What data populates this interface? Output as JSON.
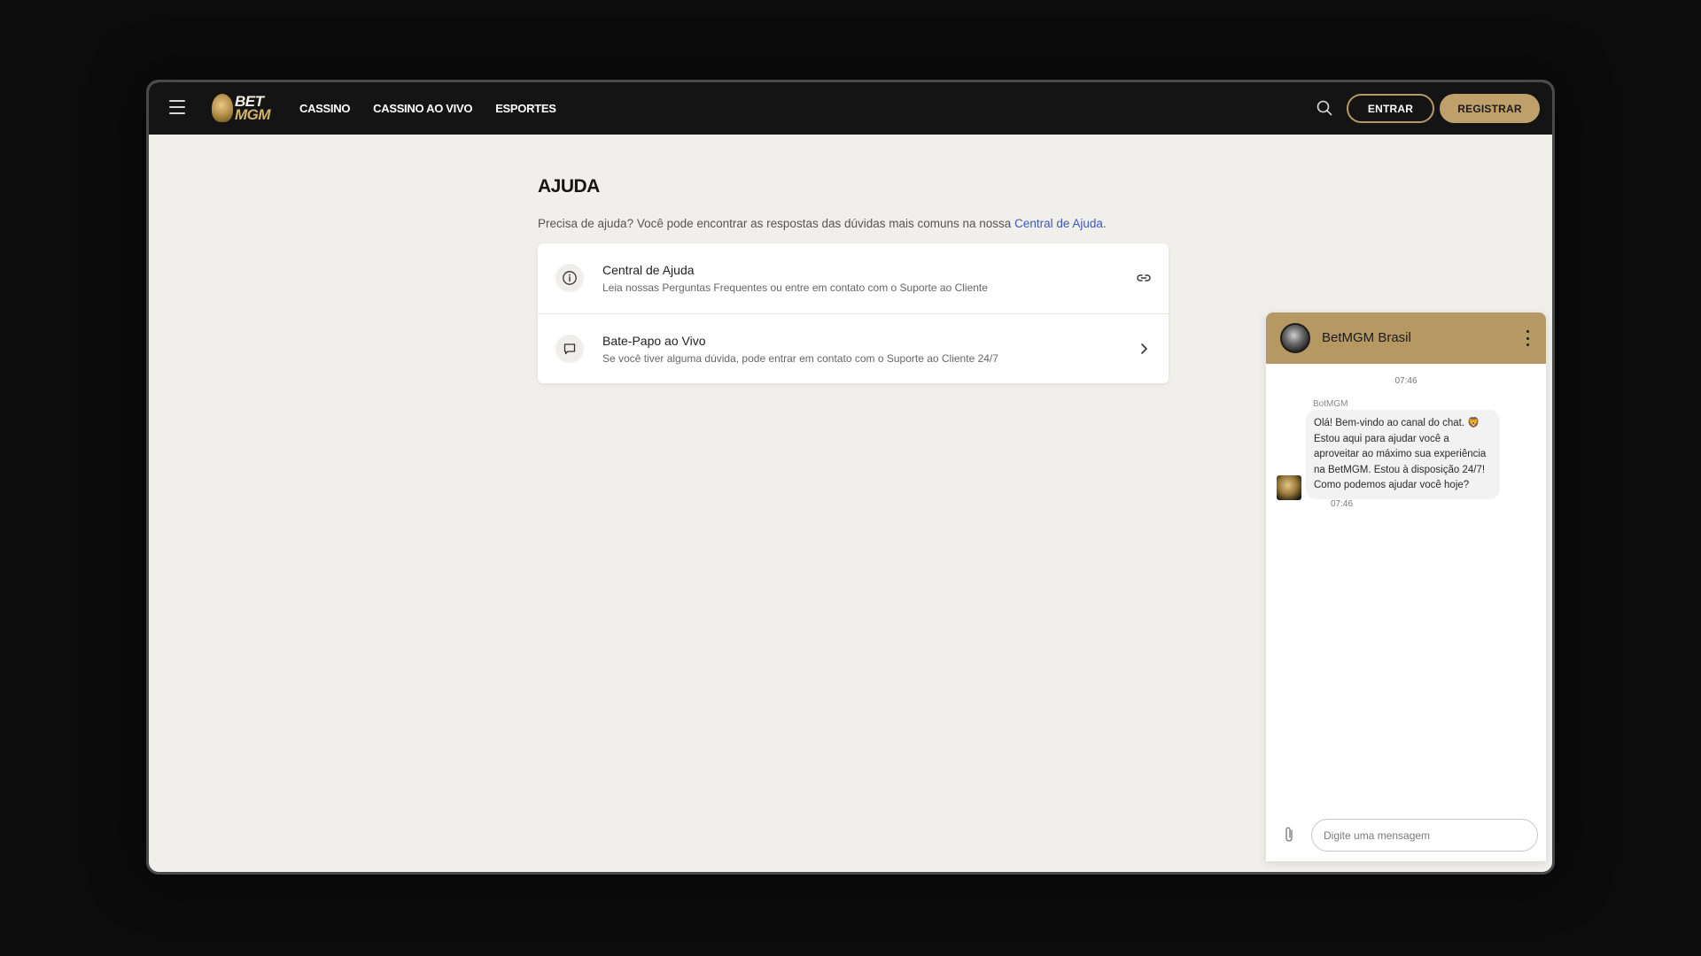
{
  "header": {
    "logo_text_top": "BET",
    "logo_text_bottom": "MGM",
    "nav": [
      {
        "label": "CASSINO"
      },
      {
        "label": "CASSINO AO VIVO"
      },
      {
        "label": "ESPORTES"
      }
    ],
    "login_label": "ENTRAR",
    "register_label": "REGISTRAR",
    "icons": [
      "menu-icon",
      "search-icon"
    ]
  },
  "main": {
    "title": "AJUDA",
    "intro_text": "Precisa de ajuda? Você pode encontrar as respostas das dúvidas mais comuns na nossa ",
    "intro_link": "Central de Ajuda",
    "intro_end": ".",
    "items": [
      {
        "title": "Central de Ajuda",
        "subtitle": "Leia nossas Perguntas Frequentes ou entre em contato com o Suporte ao Cliente",
        "icon": "info-icon",
        "action_icon": "link-icon"
      },
      {
        "title": "Bate-Papo ao Vivo",
        "subtitle": "Se você tiver alguma dúvida, pode entrar em contato com o Suporte ao Cliente 24/7",
        "icon": "chat-bubble-icon",
        "action_icon": "chevron-right-icon"
      }
    ]
  },
  "chat": {
    "title": "BetMGM Brasil",
    "time_top": "07:46",
    "sender": "BotMGM",
    "message": "Olá! Bem-vindo ao canal do chat. 🦁 Estou aqui para ajudar você a aproveitar ao máximo sua experiência na BetMGM. Estou à disposição 24/7! Como podemos ajudar você hoje?",
    "message_time": "07:46",
    "input_placeholder": "Digite uma mensagem",
    "icons": [
      "more-vertical-icon",
      "paperclip-icon"
    ]
  },
  "colors": {
    "accent_gold": "#bfa06a",
    "header_bg": "#141414",
    "page_bg": "#f1efeb",
    "link": "#3a56c9"
  }
}
